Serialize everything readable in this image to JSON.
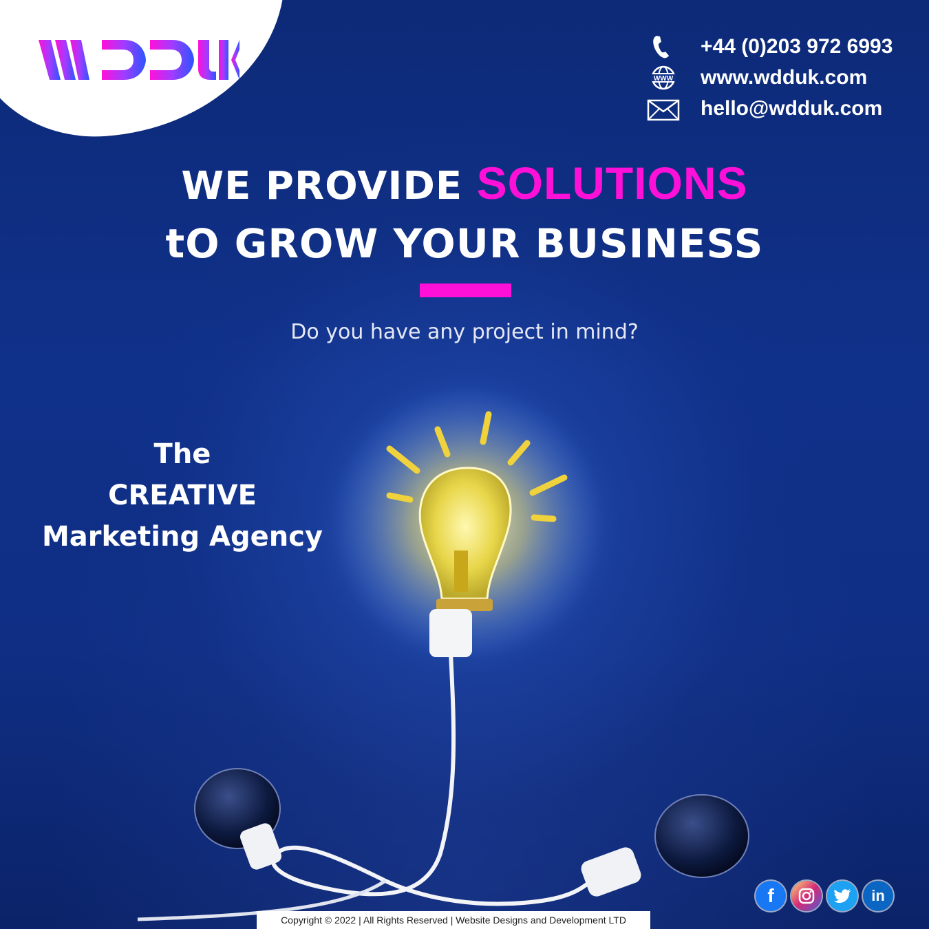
{
  "brand": {
    "logo_text": "WDDUK",
    "colors": {
      "magenta": "#ff10d8",
      "purple": "#a23cff",
      "blue": "#2b55ff",
      "background": "#10318a"
    }
  },
  "contact": {
    "phone": "+44 (0)203 972 6993",
    "website": "www.wdduk.com",
    "email": "hello@wdduk.com",
    "icons": [
      "phone-icon",
      "globe-www-icon",
      "envelope-icon"
    ]
  },
  "headline": {
    "line1_prefix": "WE PROVIDE",
    "line1_accent": "SOLUTIONS",
    "line2": "tO GROW YOUR BUSINESS"
  },
  "question": "Do you have any project in mind?",
  "tagline": {
    "line1": "The",
    "line2": "CREATIVE",
    "line3": "Marketing Agency"
  },
  "social": {
    "facebook": "f",
    "linkedin": "in",
    "icons": [
      "facebook-icon",
      "instagram-icon",
      "twitter-icon",
      "linkedin-icon"
    ]
  },
  "footer": {
    "copyright": "Copyright © 2022 | All Rights Reserved | Website Designs and Development LTD"
  }
}
